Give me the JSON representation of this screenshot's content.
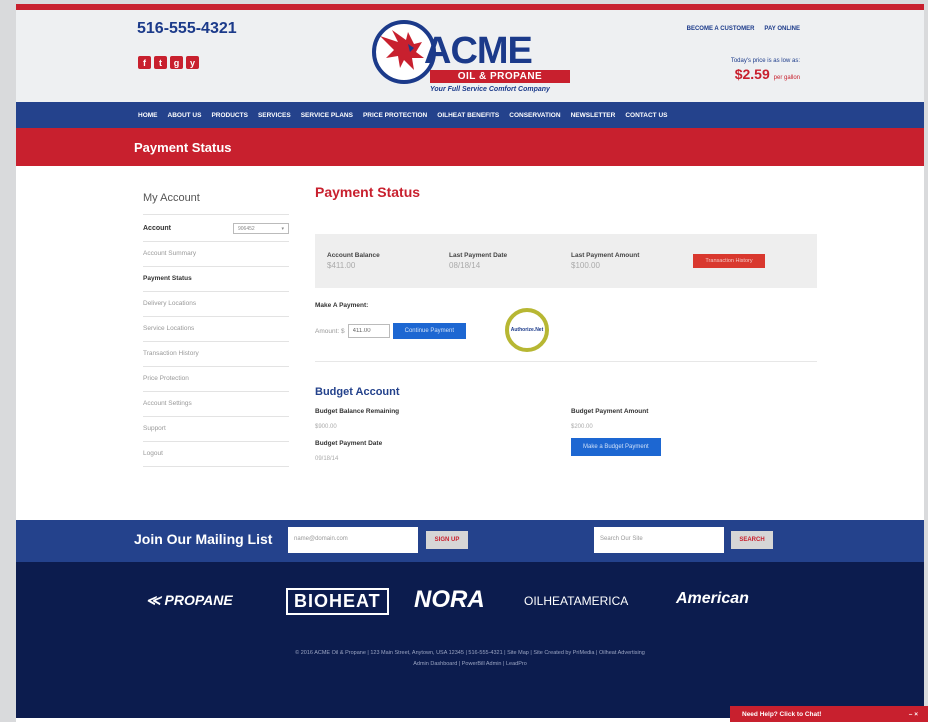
{
  "header": {
    "phone": "516-555-4321",
    "socials": [
      "f",
      "t",
      "g",
      "y"
    ],
    "logo_main": "ACME",
    "logo_sub": "OIL & PROPANE",
    "logo_tag": "Your Full Service Comfort Company",
    "top_links": [
      "BECOME A CUSTOMER",
      "PAY ONLINE"
    ],
    "price_label": "Today's price is as low as:",
    "price_value": "$2.59",
    "price_unit": "per gallon"
  },
  "nav": {
    "items": [
      "HOME",
      "ABOUT US",
      "PRODUCTS",
      "SERVICES",
      "SERVICE PLANS",
      "PRICE PROTECTION",
      "OILHEAT BENEFITS",
      "CONSERVATION",
      "NEWSLETTER",
      "CONTACT US"
    ]
  },
  "page_title": "Payment Status",
  "sidebar": {
    "title": "My Account",
    "account_label": "Account",
    "account_value": "906452",
    "items": [
      "Account Summary",
      "Payment Status",
      "Delivery Locations",
      "Service Locations",
      "Transaction History",
      "Price Protection",
      "Account Settings",
      "Support",
      "Logout"
    ],
    "active_index": 1
  },
  "main": {
    "title": "Payment Status",
    "balance": {
      "account_balance_label": "Account Balance",
      "account_balance_value": "$411.00",
      "last_payment_date_label": "Last Payment Date",
      "last_payment_date_value": "08/18/14",
      "last_payment_amount_label": "Last Payment Amount",
      "last_payment_amount_value": "$100.00",
      "button": "Transaction History"
    },
    "make_payment_label": "Make A Payment:",
    "amount_label": "Amount: $",
    "amount_value": "411.00",
    "continue_button": "Continue Payment",
    "authnet_label": "Authorize.Net",
    "budget": {
      "title": "Budget Account",
      "remaining_label": "Budget Balance Remaining",
      "remaining_value": "$900.00",
      "payment_date_label": "Budget Payment Date",
      "payment_date_value": "09/18/14",
      "payment_amount_label": "Budget Payment Amount",
      "payment_amount_value": "$200.00",
      "button": "Make a Budget Payment"
    }
  },
  "mailing": {
    "title": "Join Our Mailing List",
    "email_placeholder": "name@domain.com",
    "signup_button": "SIGN UP",
    "search_placeholder": "Search Our Site",
    "search_button": "SEARCH"
  },
  "footer": {
    "partners": [
      "PROPANE",
      "BIOHEAT",
      "NORA",
      "OILHEATAMERICA",
      "American"
    ],
    "line1": "© 2016 ACME Oil & Propane | 123 Main Street, Anytown, USA 12345 | 516-555-4321 | Site Map | Site Created by PriMedia | Oilheat Advertising",
    "line2": "Admin Dashboard | PowerBill Admin | LeadPro"
  },
  "chat": {
    "label": "Need Help? Click to Chat!",
    "controls": "– ×"
  },
  "colors": {
    "brand_red": "#c8202e",
    "brand_blue": "#24428c",
    "footer_navy": "#0c1c4e",
    "button_blue": "#1d67d2"
  }
}
